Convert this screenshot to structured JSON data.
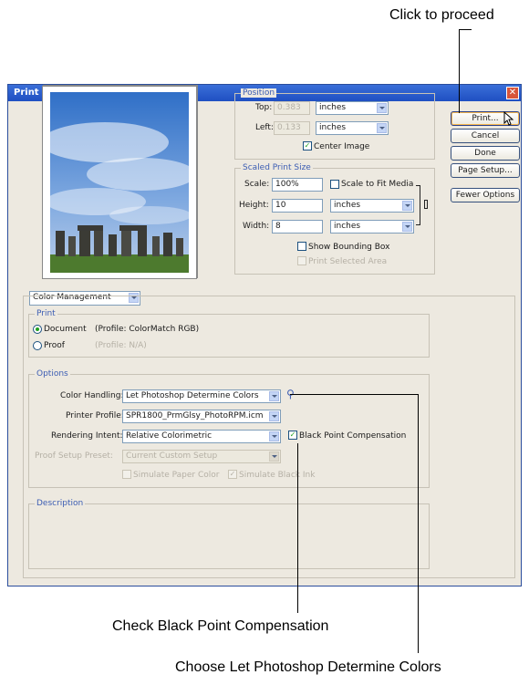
{
  "callouts": {
    "proceed": "Click to proceed",
    "black_point": "Check Black Point Compensation",
    "color_handling": "Choose Let Photoshop Determine Colors"
  },
  "dialog": {
    "title": "Print",
    "buttons": [
      "Print...",
      "Cancel",
      "Done",
      "Page Setup...",
      "Fewer Options"
    ],
    "position": {
      "label": "Position",
      "top_label": "Top:",
      "top_value": "0.383",
      "top_unit": "inches",
      "left_label": "Left:",
      "left_value": "0.133",
      "left_unit": "inches",
      "center_image": "Center Image",
      "center_checked": true
    },
    "scaled": {
      "label": "Scaled Print Size",
      "scale_label": "Scale:",
      "scale_value": "100%",
      "fit_media": "Scale to Fit Media",
      "height_label": "Height:",
      "height_value": "10",
      "height_unit": "inches",
      "width_label": "Width:",
      "width_value": "8",
      "width_unit": "inches",
      "bounding_box": "Show Bounding Box",
      "print_selected": "Print Selected Area"
    },
    "mode_select": "Color Management",
    "print_group": {
      "label": "Print",
      "document": "Document",
      "document_profile": "(Profile: ColorMatch RGB)",
      "proof": "Proof",
      "proof_profile": "(Profile: N/A)"
    },
    "options": {
      "label": "Options",
      "color_handling_label": "Color Handling:",
      "color_handling_value": "Let Photoshop Determine Colors",
      "printer_profile_label": "Printer Profile:",
      "printer_profile_value": "SPR1800_PrmGlsy_PhotoRPM.icm",
      "rendering_intent_label": "Rendering Intent:",
      "rendering_intent_value": "Relative Colorimetric",
      "black_point": "Black Point Compensation",
      "black_point_checked": true,
      "proof_setup_label": "Proof Setup Preset:",
      "proof_setup_value": "Current Custom Setup",
      "simulate_paper": "Simulate Paper Color",
      "simulate_ink": "Simulate Black Ink"
    },
    "description_label": "Description"
  },
  "colors": {
    "accent": "#3c5db3",
    "titlebar": "#1f4fc2",
    "dialog_bg": "#ede9e0"
  }
}
